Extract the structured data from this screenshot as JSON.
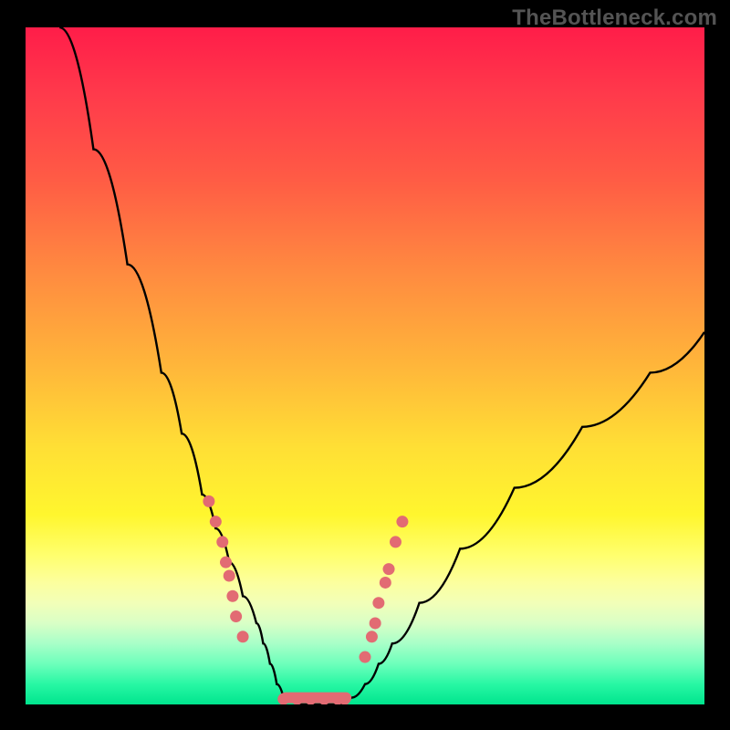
{
  "watermark": "TheBottleneck.com",
  "chart_data": {
    "type": "line",
    "title": "",
    "xlabel": "",
    "ylabel": "",
    "xlim": [
      0,
      100
    ],
    "ylim": [
      0,
      100
    ],
    "series": [
      {
        "name": "bottleneck-curve",
        "x": [
          5,
          10,
          15,
          20,
          23,
          26,
          28,
          30,
          32,
          34,
          35,
          36,
          37,
          38,
          40,
          43,
          46,
          48,
          50,
          52,
          54,
          58,
          64,
          72,
          82,
          92,
          100
        ],
        "values": [
          100,
          82,
          65,
          49,
          40,
          31,
          26,
          21,
          16,
          12,
          9,
          6,
          3,
          1,
          0,
          0,
          0,
          1,
          3,
          6,
          9,
          15,
          23,
          32,
          41,
          49,
          55
        ]
      }
    ],
    "markers": {
      "left_cluster": [
        [
          27,
          30
        ],
        [
          28,
          27
        ],
        [
          29,
          24
        ],
        [
          29.5,
          21
        ],
        [
          30,
          19
        ],
        [
          30.5,
          16
        ],
        [
          31,
          13
        ],
        [
          32,
          10
        ]
      ],
      "right_cluster": [
        [
          50,
          7
        ],
        [
          51,
          10
        ],
        [
          51.5,
          12
        ],
        [
          52,
          15
        ],
        [
          53,
          18
        ],
        [
          53.5,
          20
        ],
        [
          54.5,
          24
        ],
        [
          55.5,
          27
        ]
      ],
      "bottom_row": [
        [
          38,
          0.8
        ],
        [
          40,
          0.8
        ],
        [
          42,
          0.8
        ],
        [
          44,
          0.8
        ],
        [
          46,
          0.8
        ],
        [
          47,
          0.8
        ]
      ]
    },
    "gradient_stops": [
      {
        "pos": 0,
        "color": "#ff1d49"
      },
      {
        "pos": 50,
        "color": "#ffb63a"
      },
      {
        "pos": 78,
        "color": "#ffff6e"
      },
      {
        "pos": 100,
        "color": "#00e58e"
      }
    ],
    "marker_color": "#e26b73",
    "background": "#000000"
  }
}
